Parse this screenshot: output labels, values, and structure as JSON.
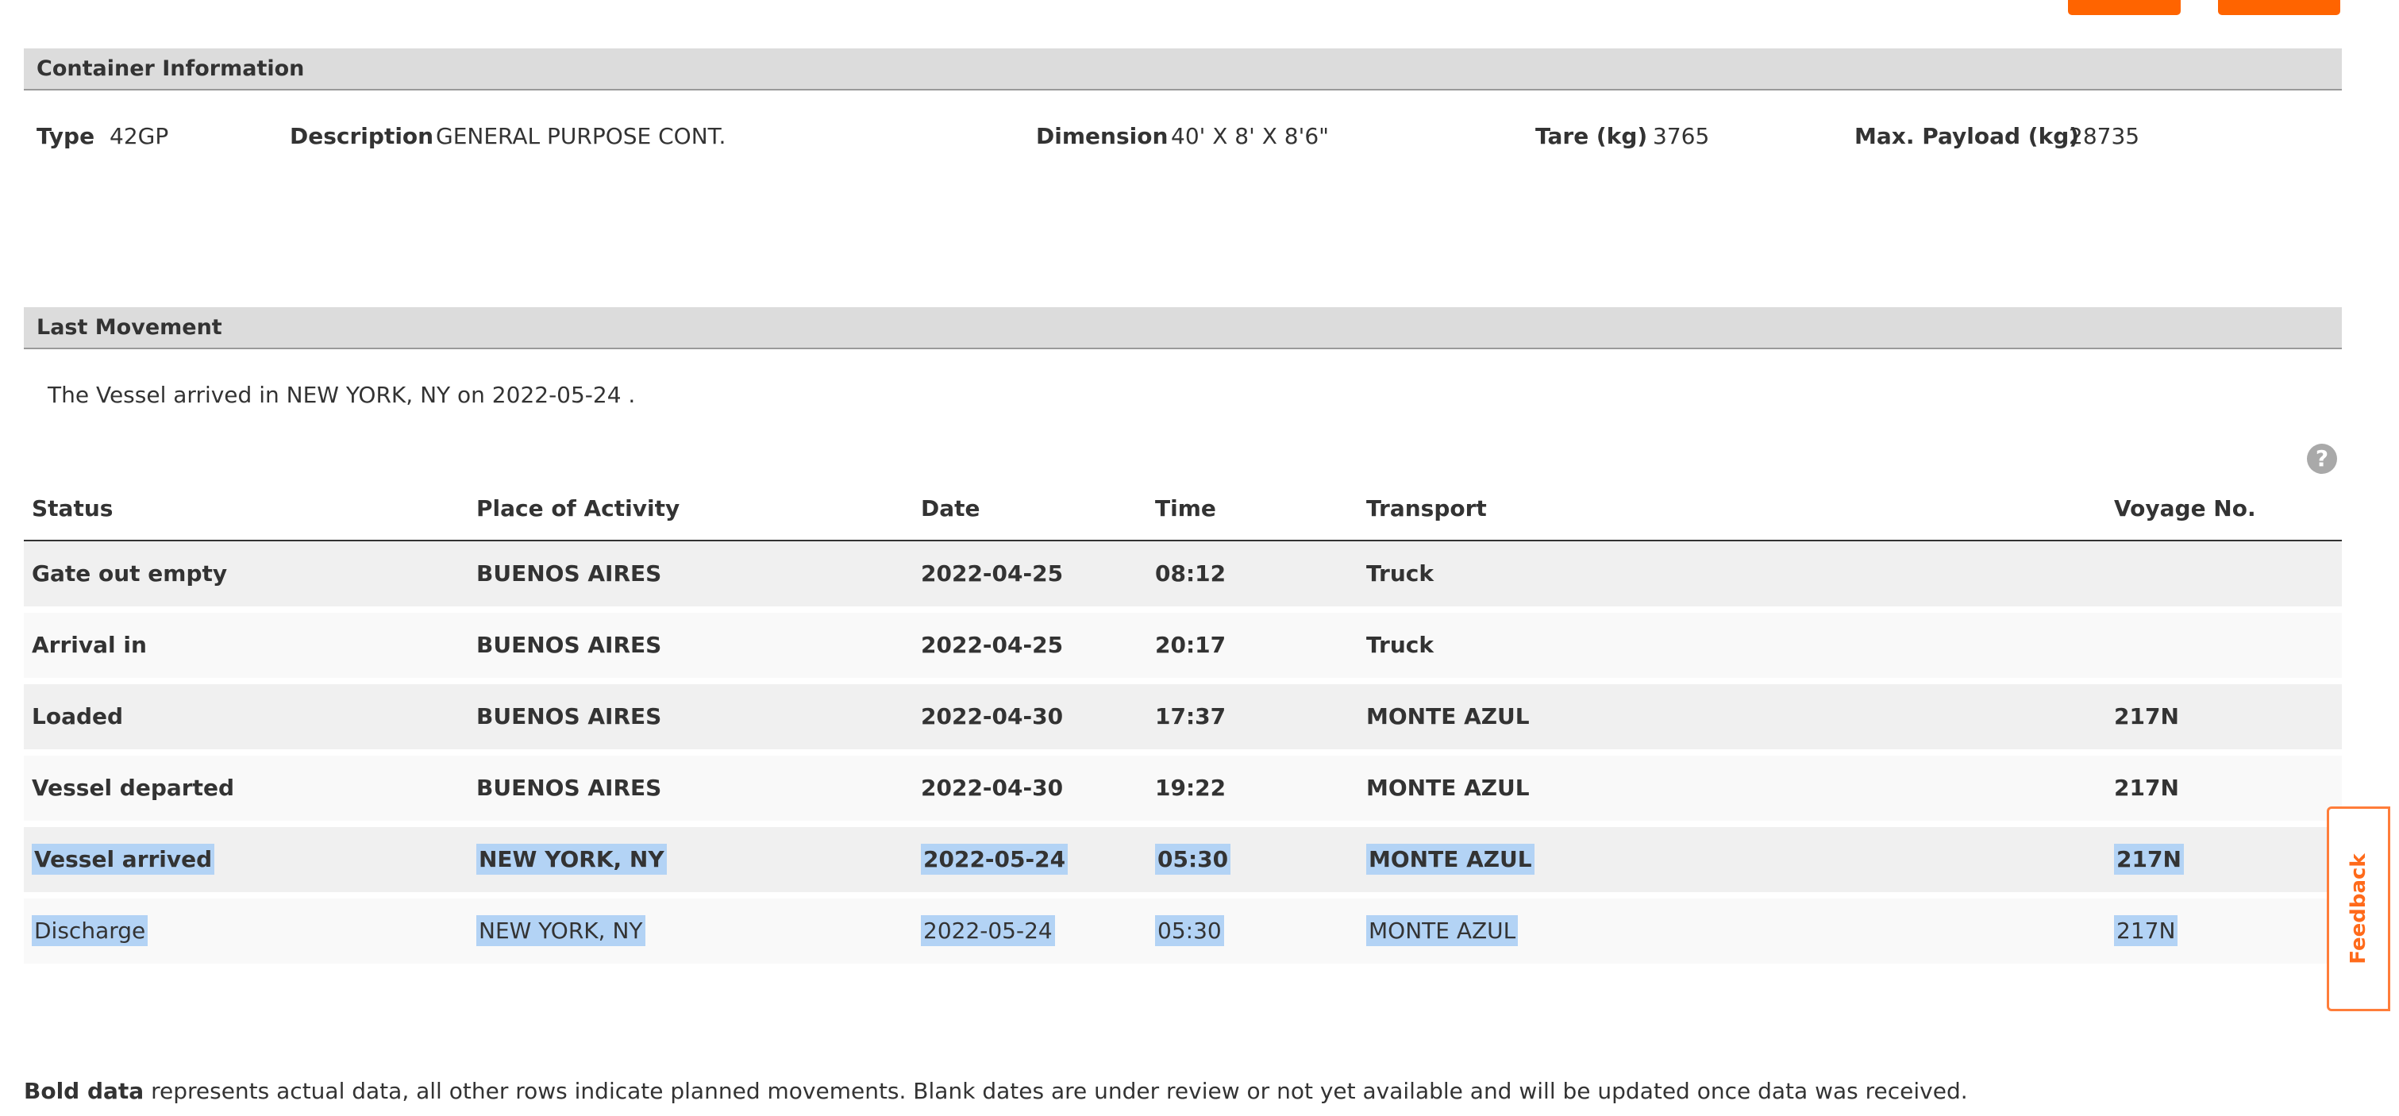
{
  "colors": {
    "accent": "#ff6400",
    "header_bg": "#dcdcdc",
    "selection": "#b3d3f5",
    "feedback": "#ff6a1a"
  },
  "container_info": {
    "title": "Container Information",
    "fields": [
      {
        "label": "Type",
        "value": "42GP"
      },
      {
        "label": "Description",
        "value": "GENERAL PURPOSE CONT."
      },
      {
        "label": "Dimension",
        "value": "40' X 8' X 8'6\""
      },
      {
        "label": "Tare (kg)",
        "value": "3765"
      },
      {
        "label": "Max. Payload (kg)",
        "value": "28735"
      }
    ]
  },
  "last_movement": {
    "title": "Last Movement",
    "summary": "The Vessel arrived in NEW YORK, NY on 2022-05-24 ."
  },
  "help_icon": "question-circle-icon",
  "help_glyph": "?",
  "table": {
    "headers": [
      "Status",
      "Place of Activity",
      "Date",
      "Time",
      "Transport",
      "Voyage No."
    ],
    "rows": [
      {
        "cells": [
          "Gate out empty",
          "BUENOS AIRES",
          "2022-04-25",
          "08:12",
          "Truck",
          ""
        ],
        "actual": true
      },
      {
        "cells": [
          "Arrival in",
          "BUENOS AIRES",
          "2022-04-25",
          "20:17",
          "Truck",
          ""
        ],
        "actual": true
      },
      {
        "cells": [
          "Loaded",
          "BUENOS AIRES",
          "2022-04-30",
          "17:37",
          "MONTE AZUL",
          "217N"
        ],
        "actual": true
      },
      {
        "cells": [
          "Vessel departed",
          "BUENOS AIRES",
          "2022-04-30",
          "19:22",
          "MONTE AZUL",
          "217N"
        ],
        "actual": true
      },
      {
        "cells": [
          "Vessel arrived",
          "NEW YORK, NY",
          "2022-05-24",
          "05:30",
          "MONTE AZUL",
          "217N"
        ],
        "actual": true,
        "selected": true
      },
      {
        "cells": [
          "Discharge",
          "NEW YORK, NY",
          "2022-05-24",
          "05:30",
          "MONTE AZUL",
          "217N"
        ],
        "actual": false,
        "selected": true
      }
    ]
  },
  "footnote": {
    "bold": "Bold data",
    "rest": " represents actual data, all other rows indicate planned movements. Blank dates are under review or not yet available and will be updated once data was received."
  },
  "feedback": {
    "label": "Feedback"
  }
}
